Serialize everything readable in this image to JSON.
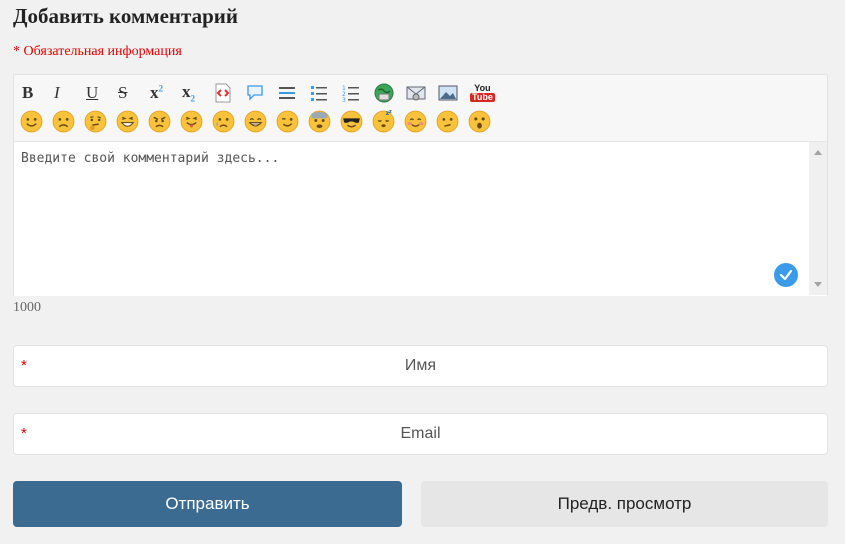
{
  "form": {
    "title": "Добавить комментарий",
    "required_note": "* Обязательная информация",
    "textarea_placeholder": "Введите свой комментарий здесь...",
    "char_counter": "1000",
    "name_placeholder": "Имя",
    "email_placeholder": "Email",
    "required_star": "*",
    "submit_label": "Отправить",
    "preview_label": "Предв. просмотр"
  },
  "toolbar": {
    "bold": "B",
    "italic": "I",
    "underline": "U",
    "strike": "S",
    "sup": "x",
    "sub": "x",
    "youtube_top": "You",
    "youtube_bottom": "Tube"
  },
  "emojis": [
    "smile",
    "sad",
    "thinking",
    "laugh",
    "angry",
    "tongue",
    "cry",
    "grin",
    "wink",
    "fear",
    "cool",
    "sleepy",
    "blush",
    "unsure",
    "surprised"
  ],
  "colors": {
    "accent": "#3b6b91",
    "required": "#e00000",
    "emoji_yellow": "#f7c23c",
    "check": "#3b9be8"
  }
}
